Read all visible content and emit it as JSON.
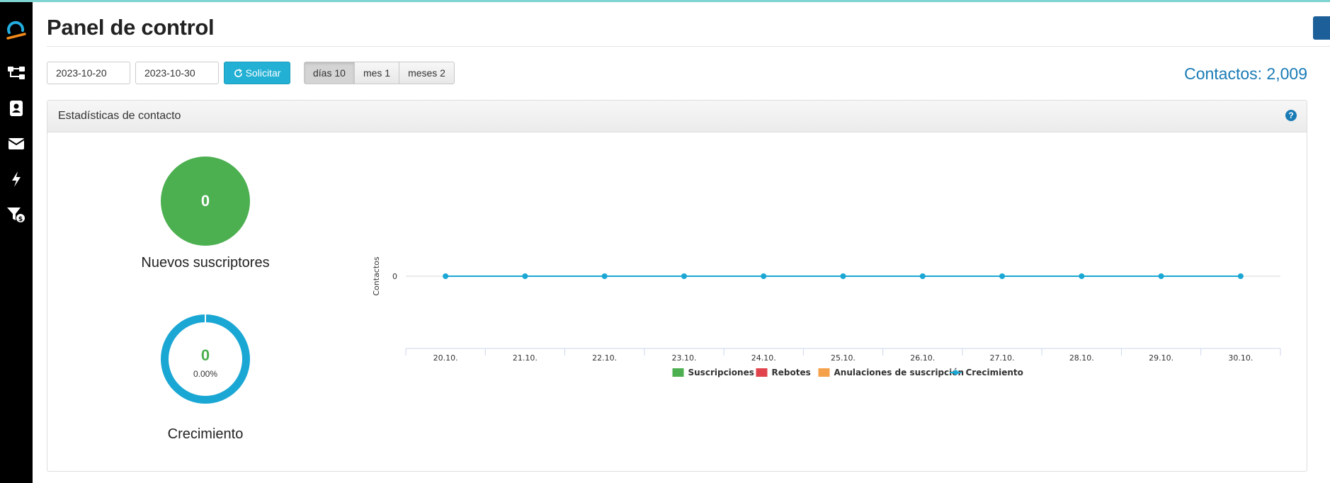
{
  "header": {
    "title": "Panel de control",
    "contacts_total": "Contactos: 2,009"
  },
  "sidebar": {
    "items": [
      {
        "icon": "logo-icon"
      },
      {
        "icon": "sitemap-icon"
      },
      {
        "icon": "contacts-book-icon"
      },
      {
        "icon": "envelope-icon"
      },
      {
        "icon": "bolt-icon"
      },
      {
        "icon": "funnel-dollar-icon"
      }
    ]
  },
  "toolbar": {
    "date_from": "2023-10-20",
    "date_to": "2023-10-30",
    "request_label": "Solicitar",
    "ranges": [
      "días 10",
      "mes 1",
      "meses 2"
    ],
    "active_range": "días 10"
  },
  "panel": {
    "title": "Estadísticas de contacto",
    "new_subscribers": {
      "value": "0",
      "label": "Nuevos suscriptores"
    },
    "growth": {
      "value": "0",
      "percent": "0.00%",
      "label": "Crecimiento"
    }
  },
  "colors": {
    "accent": "#1a7bb5",
    "button": "#22b0d4",
    "subscriptions": "#4caf50",
    "bounces": "#e0434b",
    "unsubscriptions": "#f4a14a",
    "growth": "#1aa7d4"
  },
  "chart_data": {
    "type": "line",
    "categories": [
      "20.10.",
      "21.10.",
      "22.10.",
      "23.10.",
      "24.10.",
      "25.10.",
      "26.10.",
      "27.10.",
      "28.10.",
      "29.10.",
      "30.10."
    ],
    "ylabel": "Contactos",
    "yticks": [
      "0"
    ],
    "series": [
      {
        "name": "Suscripciones",
        "type": "bar",
        "color": "#4caf50",
        "values": [
          0,
          0,
          0,
          0,
          0,
          0,
          0,
          0,
          0,
          0,
          0
        ]
      },
      {
        "name": "Rebotes",
        "type": "bar",
        "color": "#e0434b",
        "values": [
          0,
          0,
          0,
          0,
          0,
          0,
          0,
          0,
          0,
          0,
          0
        ]
      },
      {
        "name": "Anulaciones de suscripción",
        "type": "bar",
        "color": "#f4a14a",
        "values": [
          0,
          0,
          0,
          0,
          0,
          0,
          0,
          0,
          0,
          0,
          0
        ]
      },
      {
        "name": "Crecimiento",
        "type": "line",
        "color": "#1aa7d4",
        "values": [
          0,
          0,
          0,
          0,
          0,
          0,
          0,
          0,
          0,
          0,
          0
        ]
      }
    ],
    "legend": "bottom"
  }
}
